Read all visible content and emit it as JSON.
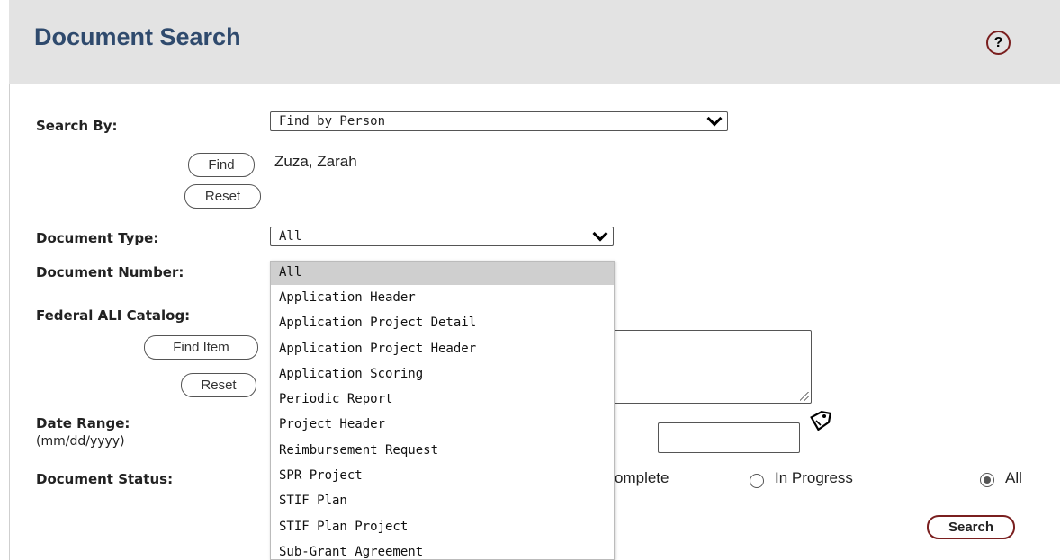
{
  "header": {
    "title": "Document Search",
    "help_label": "?"
  },
  "form": {
    "search_by": {
      "label": "Search By:",
      "value": "Find by Person"
    },
    "find_button": "Find",
    "reset_button": "Reset",
    "person_name": "Zuza, Zarah",
    "document_type": {
      "label": "Document Type:",
      "value": "All"
    },
    "document_number": {
      "label": "Document Number:"
    },
    "federal_ali": {
      "label": "Federal ALI Catalog:",
      "find_item_button": "Find Item",
      "reset_button": "Reset"
    },
    "date_range": {
      "label": "Date Range:",
      "hint": "(mm/dd/yyyy)"
    },
    "document_status": {
      "label": "Document Status:",
      "options": [
        {
          "label": "omplete",
          "checked": false
        },
        {
          "label": "In Progress",
          "checked": false
        },
        {
          "label": "All",
          "checked": true
        }
      ]
    },
    "search_button": "Search"
  },
  "dropdown": {
    "selected_index": 0,
    "options": [
      "All",
      "Application Header",
      "Application Project Detail",
      "Application Project Header",
      "Application Scoring",
      "Periodic Report",
      "Project Header",
      "Reimbursement Request",
      "SPR Project",
      "STIF Plan",
      "STIF Plan Project",
      "Sub-Grant Agreement"
    ]
  },
  "icons": {
    "help": "help-icon",
    "calendar": "tag-icon",
    "chevron": "chevron-down-icon"
  },
  "colors": {
    "title": "#2f4a6d",
    "accent": "#7a1f1f",
    "header_bg": "#e3e3e3",
    "selected_option": "#cfcfcf"
  }
}
